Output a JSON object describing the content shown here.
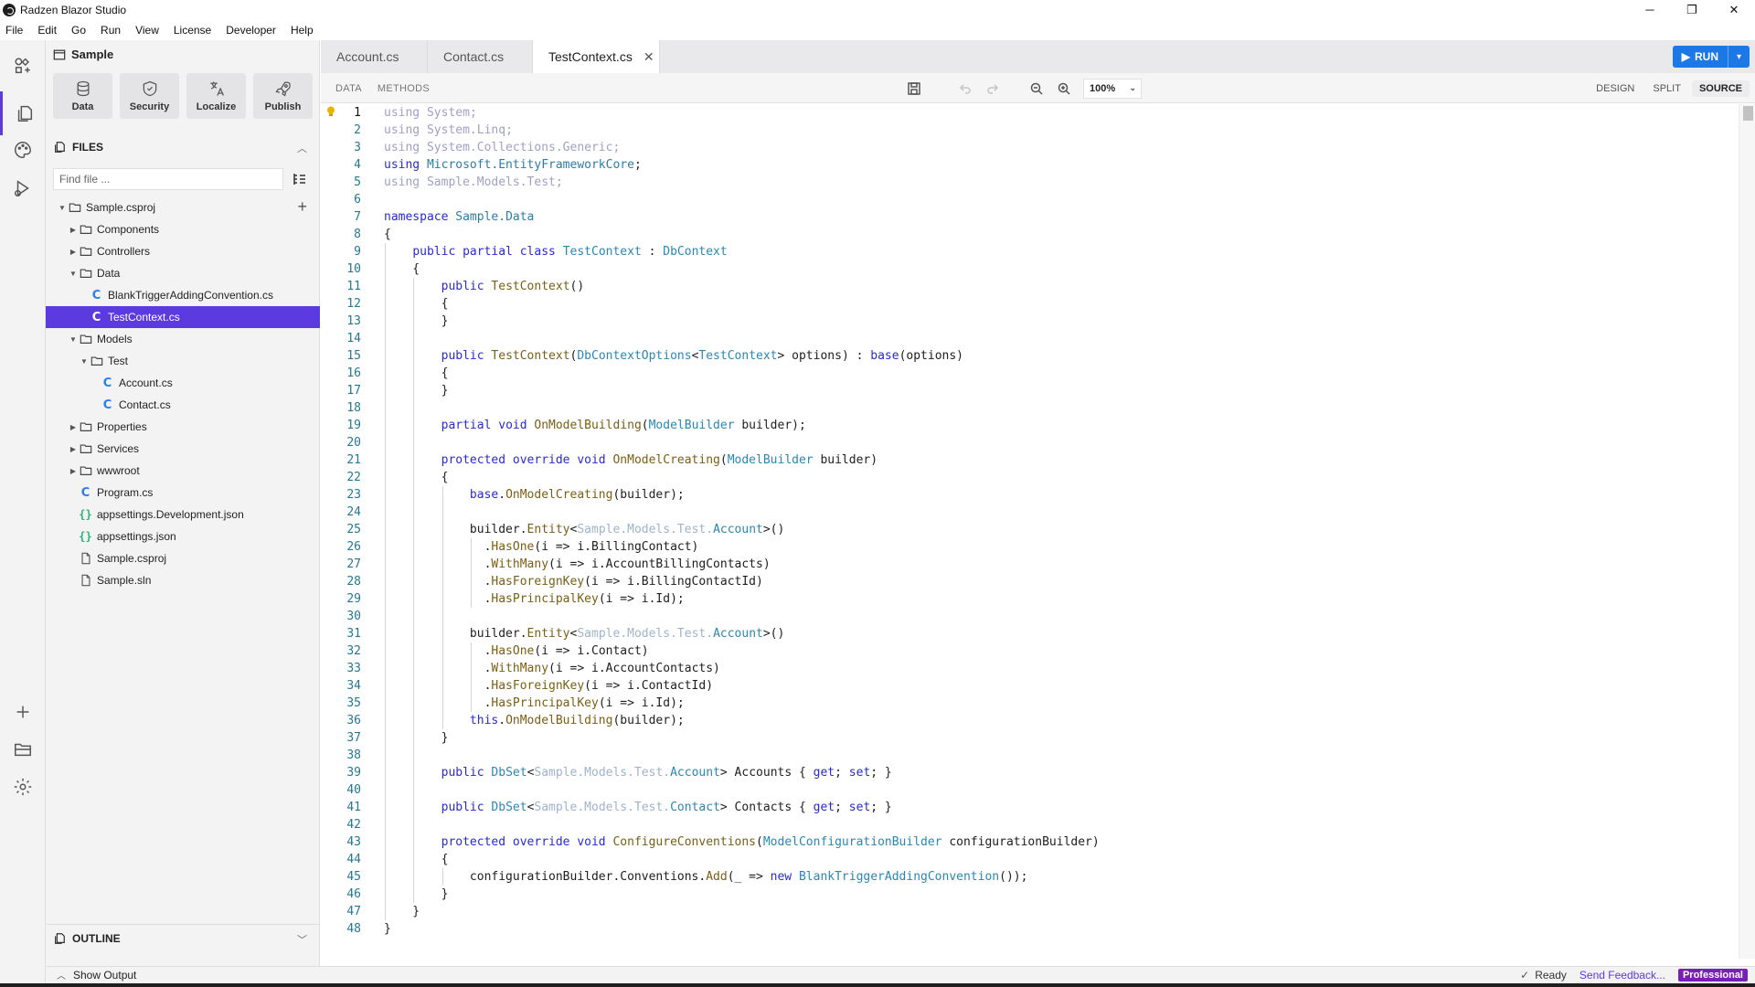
{
  "window": {
    "title": "Radzen Blazor Studio",
    "minimize": "─",
    "restore": "❐",
    "close": "✕"
  },
  "menu": [
    "File",
    "Edit",
    "Go",
    "Run",
    "View",
    "License",
    "Developer",
    "Help"
  ],
  "sidebar": {
    "project": "Sample",
    "tools": [
      {
        "label": "Data",
        "icon": "database-icon"
      },
      {
        "label": "Security",
        "icon": "shield-icon"
      },
      {
        "label": "Localize",
        "icon": "translate-icon"
      },
      {
        "label": "Publish",
        "icon": "rocket-icon"
      }
    ],
    "files_title": "FILES",
    "find_placeholder": "Find file ...",
    "tree": [
      {
        "label": "Sample.csproj",
        "level": 0,
        "type": "folder",
        "expanded": true
      },
      {
        "label": "Components",
        "level": 1,
        "type": "folder",
        "expanded": false
      },
      {
        "label": "Controllers",
        "level": 1,
        "type": "folder",
        "expanded": false
      },
      {
        "label": "Data",
        "level": 1,
        "type": "folder",
        "expanded": true
      },
      {
        "label": "BlankTriggerAddingConvention.cs",
        "level": 2,
        "type": "cs"
      },
      {
        "label": "TestContext.cs",
        "level": 2,
        "type": "cs",
        "selected": true
      },
      {
        "label": "Models",
        "level": 1,
        "type": "folder",
        "expanded": true
      },
      {
        "label": "Test",
        "level": 2,
        "type": "folder",
        "expanded": true
      },
      {
        "label": "Account.cs",
        "level": 3,
        "type": "cs"
      },
      {
        "label": "Contact.cs",
        "level": 3,
        "type": "cs"
      },
      {
        "label": "Properties",
        "level": 1,
        "type": "folder",
        "expanded": false
      },
      {
        "label": "Services",
        "level": 1,
        "type": "folder",
        "expanded": false
      },
      {
        "label": "wwwroot",
        "level": 1,
        "type": "folder",
        "expanded": false
      },
      {
        "label": "Program.cs",
        "level": 1,
        "type": "cs"
      },
      {
        "label": "appsettings.Development.json",
        "level": 1,
        "type": "json"
      },
      {
        "label": "appsettings.json",
        "level": 1,
        "type": "json"
      },
      {
        "label": "Sample.csproj",
        "level": 1,
        "type": "file"
      },
      {
        "label": "Sample.sln",
        "level": 1,
        "type": "file"
      }
    ],
    "outline_title": "OUTLINE"
  },
  "tabs": [
    {
      "label": "Account.cs",
      "active": false
    },
    {
      "label": "Contact.cs",
      "active": false
    },
    {
      "label": "TestContext.cs",
      "active": true,
      "close": "✕"
    }
  ],
  "run": {
    "label": "RUN",
    "play": "▶",
    "dropdown": "▾"
  },
  "toolbar": {
    "left_tabs": [
      "DATA",
      "METHODS"
    ],
    "zoom": "100%",
    "zoom_chevron": "⌄",
    "views": [
      {
        "label": "DESIGN",
        "active": false
      },
      {
        "label": "SPLIT",
        "active": false
      },
      {
        "label": "SOURCE",
        "active": true
      }
    ]
  },
  "editor": {
    "current_line": 1,
    "lines": [
      [
        [
          "dim",
          "using "
        ],
        [
          "dim",
          "System"
        ],
        [
          "dim",
          ";"
        ]
      ],
      [
        [
          "dim",
          "using "
        ],
        [
          "dim",
          "System.Linq"
        ],
        [
          "dim",
          ";"
        ]
      ],
      [
        [
          "dim",
          "using "
        ],
        [
          "dim",
          "System.Collections.Generic"
        ],
        [
          "dim",
          ";"
        ]
      ],
      [
        [
          "kw",
          "using "
        ],
        [
          "ns",
          "Microsoft.EntityFrameworkCore"
        ],
        [
          "",
          ""
        ],
        [
          "",
          ";"
        ]
      ],
      [
        [
          "dim",
          "using "
        ],
        [
          "dim",
          "Sample.Models.Test"
        ],
        [
          "dim",
          ";"
        ]
      ],
      [],
      [
        [
          "kw",
          "namespace "
        ],
        [
          "ns",
          "Sample.Data"
        ]
      ],
      [
        [
          "",
          "{"
        ]
      ],
      [
        [
          "",
          "    "
        ],
        [
          "kw",
          "public partial class "
        ],
        [
          "ty",
          "TestContext"
        ],
        [
          "",
          " : "
        ],
        [
          "ty",
          "DbContext"
        ]
      ],
      [
        [
          "",
          "    {"
        ]
      ],
      [
        [
          "",
          "        "
        ],
        [
          "kw",
          "public "
        ],
        [
          "fn",
          "TestContext"
        ],
        [
          "",
          "()"
        ]
      ],
      [
        [
          "",
          "        {"
        ]
      ],
      [
        [
          "",
          "        }"
        ]
      ],
      [],
      [
        [
          "",
          "        "
        ],
        [
          "kw",
          "public "
        ],
        [
          "fn",
          "TestContext"
        ],
        [
          "",
          "("
        ],
        [
          "ty",
          "DbContextOptions"
        ],
        [
          "",
          "<"
        ],
        [
          "ty",
          "TestContext"
        ],
        [
          "",
          "> options) : "
        ],
        [
          "kw",
          "base"
        ],
        [
          "",
          "(options)"
        ]
      ],
      [
        [
          "",
          "        {"
        ]
      ],
      [
        [
          "",
          "        }"
        ]
      ],
      [],
      [
        [
          "",
          "        "
        ],
        [
          "kw",
          "partial void "
        ],
        [
          "fn",
          "OnModelBuilding"
        ],
        [
          "",
          "("
        ],
        [
          "ty",
          "ModelBuilder"
        ],
        [
          "",
          " builder);"
        ]
      ],
      [],
      [
        [
          "",
          "        "
        ],
        [
          "kw",
          "protected override void "
        ],
        [
          "fn",
          "OnModelCreating"
        ],
        [
          "",
          "("
        ],
        [
          "ty",
          "ModelBuilder"
        ],
        [
          "",
          " builder)"
        ]
      ],
      [
        [
          "",
          "        {"
        ]
      ],
      [
        [
          "",
          "            "
        ],
        [
          "kw",
          "base"
        ],
        [
          "",
          "."
        ],
        [
          "fn",
          "OnModelCreating"
        ],
        [
          "",
          "(builder);"
        ]
      ],
      [],
      [
        [
          "",
          "            builder."
        ],
        [
          "fn",
          "Entity"
        ],
        [
          "",
          "<"
        ],
        [
          "dimt",
          "Sample.Models.Test."
        ],
        [
          "ty",
          "Account"
        ],
        [
          "",
          ">()"
        ]
      ],
      [
        [
          "",
          "              ."
        ],
        [
          "fn",
          "HasOne"
        ],
        [
          "",
          "(i => i.BillingContact)"
        ]
      ],
      [
        [
          "",
          "              ."
        ],
        [
          "fn",
          "WithMany"
        ],
        [
          "",
          "(i => i.AccountBillingContacts)"
        ]
      ],
      [
        [
          "",
          "              ."
        ],
        [
          "fn",
          "HasForeignKey"
        ],
        [
          "",
          "(i => i.BillingContactId)"
        ]
      ],
      [
        [
          "",
          "              ."
        ],
        [
          "fn",
          "HasPrincipalKey"
        ],
        [
          "",
          "(i => i.Id);"
        ]
      ],
      [],
      [
        [
          "",
          "            builder."
        ],
        [
          "fn",
          "Entity"
        ],
        [
          "",
          "<"
        ],
        [
          "dimt",
          "Sample.Models.Test."
        ],
        [
          "ty",
          "Account"
        ],
        [
          "",
          ">()"
        ]
      ],
      [
        [
          "",
          "              ."
        ],
        [
          "fn",
          "HasOne"
        ],
        [
          "",
          "(i => i.Contact)"
        ]
      ],
      [
        [
          "",
          "              ."
        ],
        [
          "fn",
          "WithMany"
        ],
        [
          "",
          "(i => i.AccountContacts)"
        ]
      ],
      [
        [
          "",
          "              ."
        ],
        [
          "fn",
          "HasForeignKey"
        ],
        [
          "",
          "(i => i.ContactId)"
        ]
      ],
      [
        [
          "",
          "              ."
        ],
        [
          "fn",
          "HasPrincipalKey"
        ],
        [
          "",
          "(i => i.Id);"
        ]
      ],
      [
        [
          "",
          "            "
        ],
        [
          "kw",
          "this"
        ],
        [
          "",
          "."
        ],
        [
          "fn",
          "OnModelBuilding"
        ],
        [
          "",
          "(builder);"
        ]
      ],
      [
        [
          "",
          "        }"
        ]
      ],
      [],
      [
        [
          "",
          "        "
        ],
        [
          "kw",
          "public "
        ],
        [
          "ty",
          "DbSet"
        ],
        [
          "",
          "<"
        ],
        [
          "dimt",
          "Sample.Models.Test."
        ],
        [
          "ty",
          "Account"
        ],
        [
          "",
          "> Accounts { "
        ],
        [
          "kw",
          "get"
        ],
        [
          "",
          "; "
        ],
        [
          "kw",
          "set"
        ],
        [
          "",
          "; }"
        ]
      ],
      [],
      [
        [
          "",
          "        "
        ],
        [
          "kw",
          "public "
        ],
        [
          "ty",
          "DbSet"
        ],
        [
          "",
          "<"
        ],
        [
          "dimt",
          "Sample.Models.Test."
        ],
        [
          "ty",
          "Contact"
        ],
        [
          "",
          "> Contacts { "
        ],
        [
          "kw",
          "get"
        ],
        [
          "",
          "; "
        ],
        [
          "kw",
          "set"
        ],
        [
          "",
          "; }"
        ]
      ],
      [],
      [
        [
          "",
          "        "
        ],
        [
          "kw",
          "protected override void "
        ],
        [
          "fn",
          "ConfigureConventions"
        ],
        [
          "",
          "("
        ],
        [
          "ty",
          "ModelConfigurationBuilder"
        ],
        [
          "",
          " configurationBuilder)"
        ]
      ],
      [
        [
          "",
          "        {"
        ]
      ],
      [
        [
          "",
          "            configurationBuilder.Conventions."
        ],
        [
          "fn",
          "Add"
        ],
        [
          "",
          "(_ => "
        ],
        [
          "kw",
          "new "
        ],
        [
          "ty",
          "BlankTriggerAddingConvention"
        ],
        [
          "",
          "());"
        ]
      ],
      [
        [
          "",
          "        }"
        ]
      ],
      [
        [
          "",
          "    }"
        ]
      ],
      [
        [
          "",
          "}"
        ]
      ]
    ]
  },
  "status": {
    "show_output": "Show Output",
    "ready": "Ready",
    "feedback": "Send Feedback...",
    "edition": "Professional"
  }
}
